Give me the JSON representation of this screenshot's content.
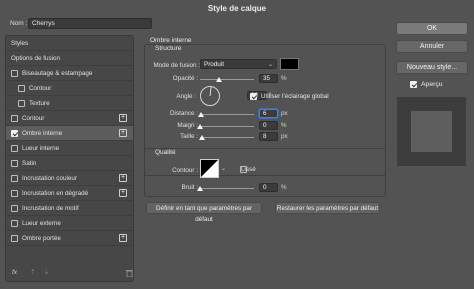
{
  "window": {
    "title": "Style de calque"
  },
  "name_field": {
    "label": "Nom :",
    "value": "Cherrys"
  },
  "styles_panel": {
    "header": "Styles",
    "items": [
      {
        "label": "Options de fusion",
        "checkbox": false,
        "checked": false,
        "plus": false,
        "indent": false,
        "selected": false
      },
      {
        "label": "Biseautage & estampage",
        "checkbox": true,
        "checked": false,
        "plus": false,
        "indent": false,
        "selected": false
      },
      {
        "label": "Contour",
        "checkbox": true,
        "checked": false,
        "plus": false,
        "indent": true,
        "selected": false
      },
      {
        "label": "Texture",
        "checkbox": true,
        "checked": false,
        "plus": false,
        "indent": true,
        "selected": false
      },
      {
        "label": "Contour",
        "checkbox": true,
        "checked": false,
        "plus": true,
        "indent": false,
        "selected": false
      },
      {
        "label": "Ombre interne",
        "checkbox": true,
        "checked": true,
        "plus": true,
        "indent": false,
        "selected": true
      },
      {
        "label": "Lueur interne",
        "checkbox": true,
        "checked": false,
        "plus": false,
        "indent": false,
        "selected": false
      },
      {
        "label": "Satin",
        "checkbox": true,
        "checked": false,
        "plus": false,
        "indent": false,
        "selected": false
      },
      {
        "label": "Incrustation couleur",
        "checkbox": true,
        "checked": false,
        "plus": true,
        "indent": false,
        "selected": false
      },
      {
        "label": "Incrustation en dégradé",
        "checkbox": true,
        "checked": false,
        "plus": true,
        "indent": false,
        "selected": false
      },
      {
        "label": "Incrustation de motif",
        "checkbox": true,
        "checked": false,
        "plus": false,
        "indent": false,
        "selected": false
      },
      {
        "label": "Lueur externe",
        "checkbox": true,
        "checked": false,
        "plus": false,
        "indent": false,
        "selected": false
      },
      {
        "label": "Ombre portée",
        "checkbox": true,
        "checked": false,
        "plus": true,
        "indent": false,
        "selected": false
      }
    ],
    "footer_icons": [
      "fx-icon",
      "arrow-up-icon",
      "arrow-down-icon",
      "trash-icon"
    ],
    "fx_label": "fx"
  },
  "inner_shadow": {
    "title": "Ombre interne",
    "structure": {
      "title": "Structure",
      "blend_mode_label": "Mode de fusion :",
      "blend_mode_value": "Produit",
      "color": "#000000",
      "opacity_label": "Opacité :",
      "opacity_value": "35",
      "opacity_unit": "%",
      "opacity_fraction": 0.35,
      "angle_label": "Angle :",
      "angle_value": "83",
      "angle_unit": "°",
      "global_light_label": "Utiliser l'éclairage global",
      "global_light_checked": true,
      "distance_label": "Distance :",
      "distance_value": "6",
      "distance_unit": "px",
      "distance_fraction": 0.02,
      "choke_label": "Maigri :",
      "choke_value": "0",
      "choke_unit": "%",
      "choke_fraction": 0.0,
      "size_label": "Taille :",
      "size_value": "8",
      "size_unit": "px",
      "size_fraction": 0.03
    },
    "quality": {
      "title": "Qualité",
      "contour_label": "Contour :",
      "antialias_label": "Lissé",
      "antialias_checked": false,
      "noise_label": "Bruit :",
      "noise_value": "0",
      "noise_unit": "%",
      "noise_fraction": 0.0
    },
    "make_default_label": "Définir en tant que paramètres par défaut",
    "reset_default_label": "Restaurer les paramètres par défaut"
  },
  "right_panel": {
    "ok_label": "OK",
    "cancel_label": "Annuler",
    "new_style_label": "Nouveau style...",
    "preview_label": "Aperçu",
    "preview_checked": true
  }
}
